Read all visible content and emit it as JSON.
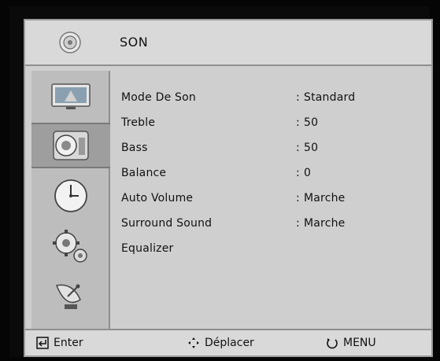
{
  "header": {
    "title": "SON",
    "icon": "speaker-icon"
  },
  "sidebar": {
    "items": [
      {
        "name": "picture",
        "icon": "tv-picture-icon"
      },
      {
        "name": "sound",
        "icon": "speaker-icon",
        "active": true
      },
      {
        "name": "time",
        "icon": "clock-icon"
      },
      {
        "name": "setup",
        "icon": "gears-icon"
      },
      {
        "name": "channel",
        "icon": "satellite-dish-icon"
      }
    ]
  },
  "menu": {
    "items": [
      {
        "label": "Mode De Son",
        "value": "Standard"
      },
      {
        "label": "Treble",
        "value": "50"
      },
      {
        "label": "Bass",
        "value": "50"
      },
      {
        "label": "Balance",
        "value": "0"
      },
      {
        "label": "Auto Volume",
        "value": "Marche"
      },
      {
        "label": "Surround Sound",
        "value": "Marche"
      },
      {
        "label": "Equalizer",
        "value": ""
      }
    ]
  },
  "footer": {
    "enter_label": "Enter",
    "move_label": "Déplacer",
    "menu_label": "MENU"
  }
}
